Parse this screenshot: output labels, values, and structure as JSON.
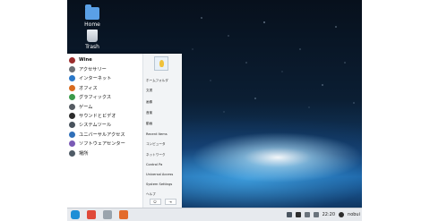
{
  "desktop": {
    "icons": [
      {
        "label": "Home",
        "icon": "folder-icon"
      },
      {
        "label": "Trash",
        "icon": "trash-icon"
      }
    ]
  },
  "menu": {
    "categories": [
      {
        "label": "Wine",
        "icon": "wine-icon",
        "color": "#9b2d2d"
      },
      {
        "label": "アクセサリー",
        "icon": "accessories-icon",
        "color": "#6b6f75"
      },
      {
        "label": "インターネット",
        "icon": "internet-icon",
        "color": "#2a78c9"
      },
      {
        "label": "オフィス",
        "icon": "office-icon",
        "color": "#d86b1f"
      },
      {
        "label": "グラフィックス",
        "icon": "graphics-icon",
        "color": "#3b9a4a"
      },
      {
        "label": "ゲーム",
        "icon": "games-icon",
        "color": "#555b62"
      },
      {
        "label": "サウンドとビデオ",
        "icon": "multimedia-icon",
        "color": "#2b2b2b"
      },
      {
        "label": "システムツール",
        "icon": "system-tools-icon",
        "color": "#48525c"
      },
      {
        "label": "ユニバーサルアクセス",
        "icon": "universal-access-icon",
        "color": "#2f6fb8"
      },
      {
        "label": "ソフトウェアセンター",
        "icon": "software-center-icon",
        "color": "#7a5ab5"
      },
      {
        "label": "場所",
        "icon": "places-icon",
        "color": "#4f5b66"
      }
    ],
    "places": [
      "ホームフォルダ",
      "文書",
      "画像",
      "音楽",
      "動画",
      "Recent Items",
      "コンピュータ",
      "ネットワーク",
      "Control Pa",
      "Universal Access",
      "System Settings",
      "ヘルプ"
    ],
    "power": {
      "lock_glyph": "⏻",
      "logout_glyph": "⇥"
    }
  },
  "taskbar": {
    "apps": [
      {
        "name": "zorin-menu-icon",
        "color": "#1f8fd6"
      },
      {
        "name": "chrome-icon",
        "color": "#e04a3a"
      },
      {
        "name": "files-icon",
        "color": "#9aa4ad"
      },
      {
        "name": "settings-icon",
        "color": "#e36b2b"
      }
    ],
    "clock": "22:20",
    "user": "nobui"
  }
}
